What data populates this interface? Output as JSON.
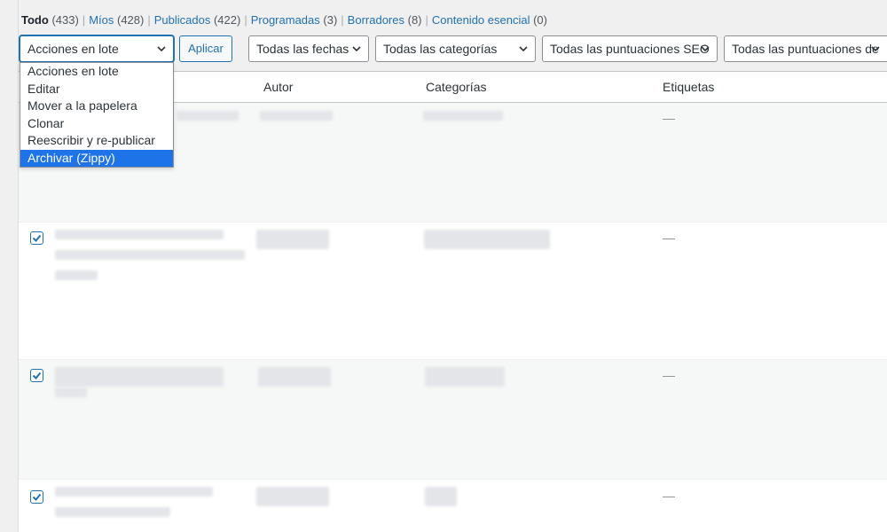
{
  "status_filters": [
    {
      "label": "Todo",
      "count": "(433)",
      "current": true
    },
    {
      "label": "Míos",
      "count": "(428)",
      "current": false
    },
    {
      "label": "Publicados",
      "count": "(422)",
      "current": false
    },
    {
      "label": "Programadas",
      "count": "(3)",
      "current": false
    },
    {
      "label": "Borradores",
      "count": "(8)",
      "current": false
    },
    {
      "label": "Contenido esencial",
      "count": "(0)",
      "current": false
    }
  ],
  "separator": "|",
  "toolbar": {
    "bulk_actions": "Acciones en lote",
    "apply": "Aplicar",
    "dates": "Todas las fechas",
    "categories": "Todas las categorías",
    "seo_scores": "Todas las puntuaciones SEO",
    "readability_scores": "Todas las puntuaciones de"
  },
  "dropdown": {
    "options": [
      "Acciones en lote",
      "Editar",
      "Mover a la papelera",
      "Clonar",
      "Reescribir y re-publicar",
      "Archivar (Zippy)"
    ],
    "selected": "Archivar (Zippy)"
  },
  "table": {
    "columns": {
      "author": "Autor",
      "categories": "Categorías",
      "tags": "Etiquetas"
    },
    "rows": [
      {
        "checked": false,
        "tags": "—"
      },
      {
        "checked": true,
        "tags": "—"
      },
      {
        "checked": true,
        "tags": "—"
      },
      {
        "checked": true,
        "tags": "—"
      }
    ]
  },
  "colors": {
    "accent": "#2271b1",
    "selected_option": "#1e73e8",
    "background": "#f0f0f1"
  }
}
